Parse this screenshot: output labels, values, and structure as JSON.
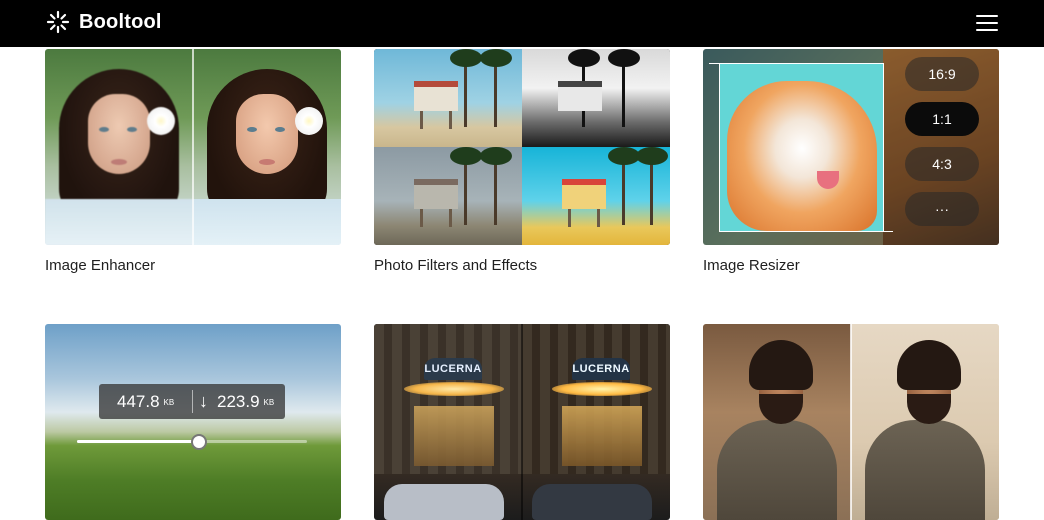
{
  "header": {
    "brand_name": "Booltool",
    "logo_icon": "sparkle-burst-icon",
    "menu_icon": "hamburger-menu-icon"
  },
  "tools": [
    {
      "title": "Image Enhancer"
    },
    {
      "title": "Photo Filters and Effects"
    },
    {
      "title": "Image Resizer",
      "ratio_options": [
        "16:9",
        "1:1",
        "4:3",
        "···"
      ],
      "selected_ratio": "1:1"
    },
    {
      "original_size": "447.8",
      "compressed_size": "223.9",
      "unit": "KB",
      "reduction_arrow": "↓",
      "slider_position": 0.53
    },
    {
      "sign_text": "LUCERNA"
    },
    {}
  ],
  "colors": {
    "header_bg": "#000000",
    "active_chip": "#0b0b0b"
  }
}
